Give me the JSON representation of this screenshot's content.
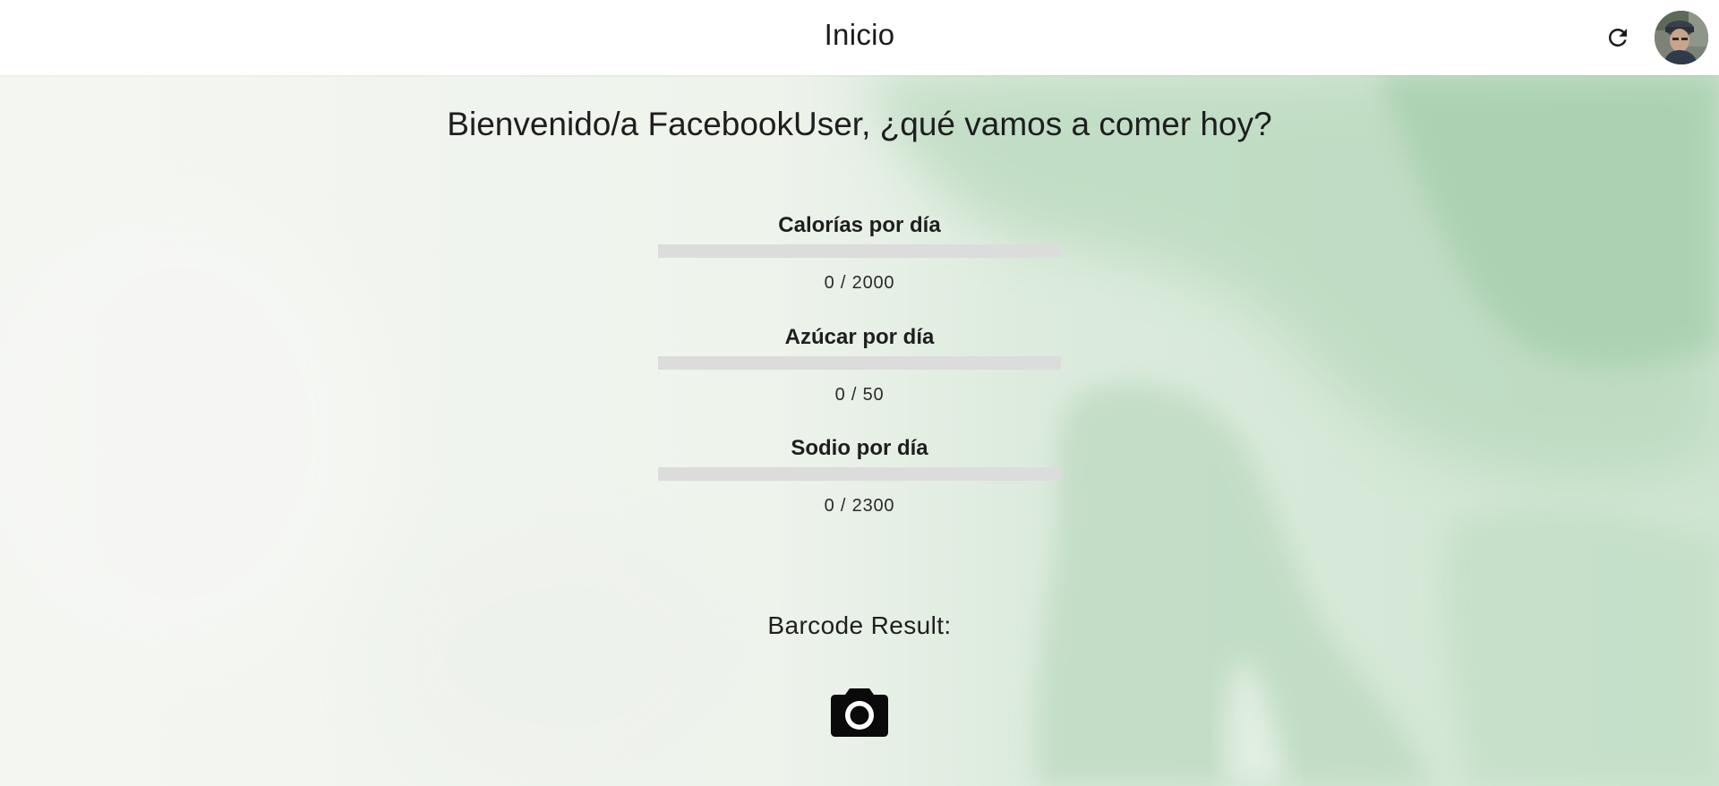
{
  "appbar": {
    "title": "Inicio",
    "refresh_icon": "refresh-icon",
    "avatar_icon": "user-avatar"
  },
  "main": {
    "welcome": "Bienvenido/a FacebookUser, ¿qué vamos a comer hoy?",
    "metrics": [
      {
        "label": "Calorías por día",
        "value": "0 / 2000",
        "current": 0,
        "max": 2000
      },
      {
        "label": "Azúcar por día",
        "value": "0 / 50",
        "current": 0,
        "max": 50
      },
      {
        "label": "Sodio por día",
        "value": "0 / 2300",
        "current": 0,
        "max": 2300
      }
    ],
    "barcode_label": "Barcode Result:",
    "camera_icon": "camera-icon"
  },
  "colors": {
    "appbar_bg": "#ffffff",
    "progress_track": "#dcdcdc",
    "background_base": "#f3f6f2",
    "background_green": "#a9cfae"
  }
}
